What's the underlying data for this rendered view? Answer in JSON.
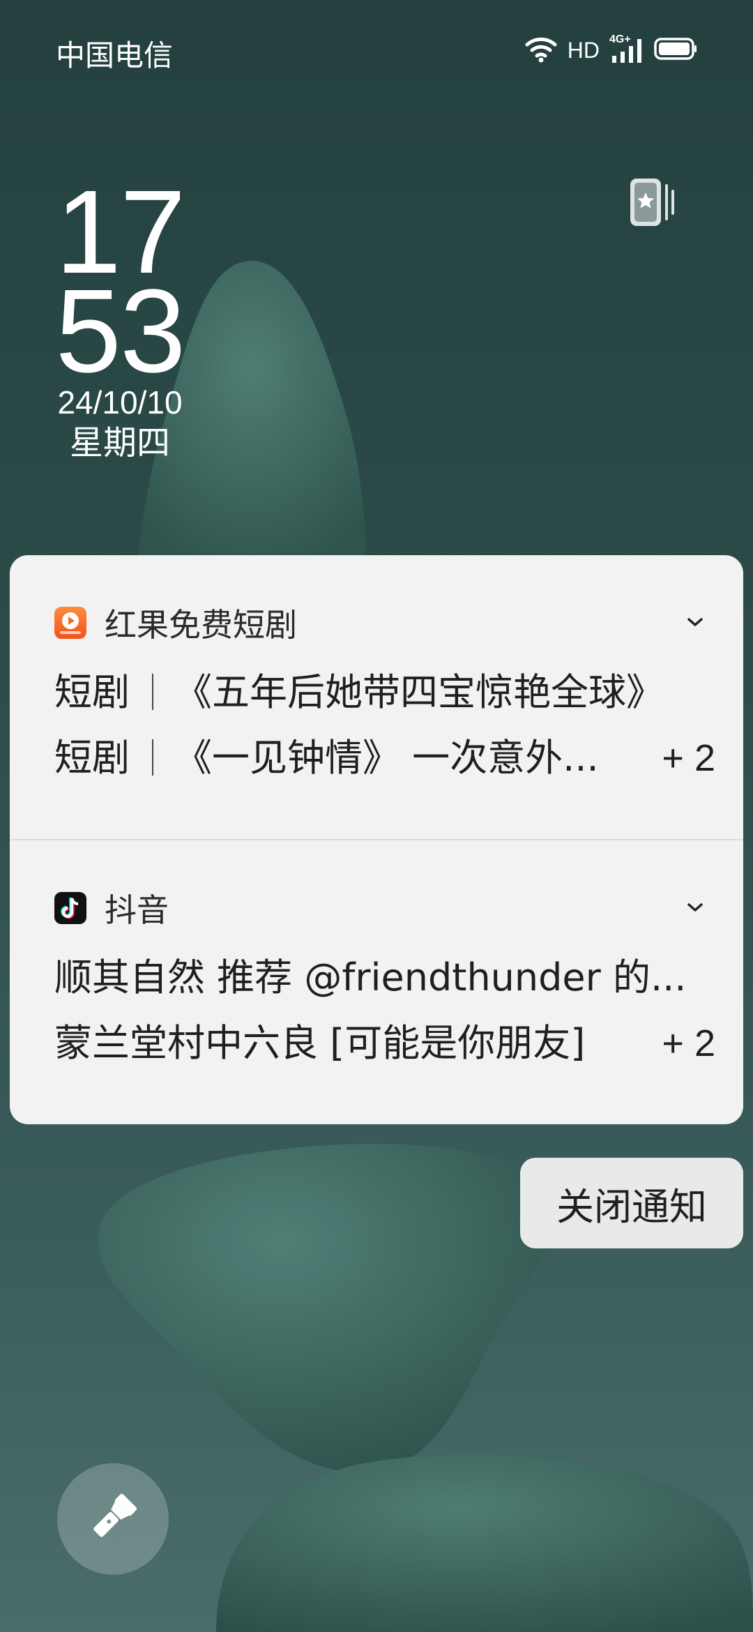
{
  "status_bar": {
    "carrier": "中国电信",
    "network_label": "HD",
    "mobile_label": "4G+",
    "icons": [
      "wifi-icon",
      "signal-icon",
      "battery-icon"
    ]
  },
  "lockscreen": {
    "hour": "17",
    "minute": "53",
    "date": "24/10/10",
    "weekday": "星期四",
    "widget_icon": "wallpaper-favorite-icon"
  },
  "notifications": [
    {
      "app_name": "红果免费短剧",
      "app_icon": "hongguo-app-icon",
      "lines": [
        {
          "prefix": "短剧",
          "text": "《五年后她带四宝惊艳全球》"
        },
        {
          "prefix": "短剧",
          "text": "《一见钟情》 一次意外..."
        }
      ],
      "more_count": "+ 2"
    },
    {
      "app_name": "抖音",
      "app_icon": "douyin-app-icon",
      "lines": [
        {
          "text": "顺其自然  推荐 @friendthunder 的..."
        },
        {
          "text": "蒙兰堂村中六良 [可能是你朋友]"
        }
      ],
      "more_count": "+ 2"
    }
  ],
  "actions": {
    "close_notifications": "关闭通知",
    "shortcut_icon": "flashlight-icon"
  },
  "colors": {
    "wallpaper_top": "#23403e",
    "wallpaper_bottom": "#4a6c6b",
    "stone": "#3e6a62",
    "card_bg": "#f2f2f3",
    "hongguo_orange": "#f26a2a",
    "douyin_bg": "#111111"
  }
}
